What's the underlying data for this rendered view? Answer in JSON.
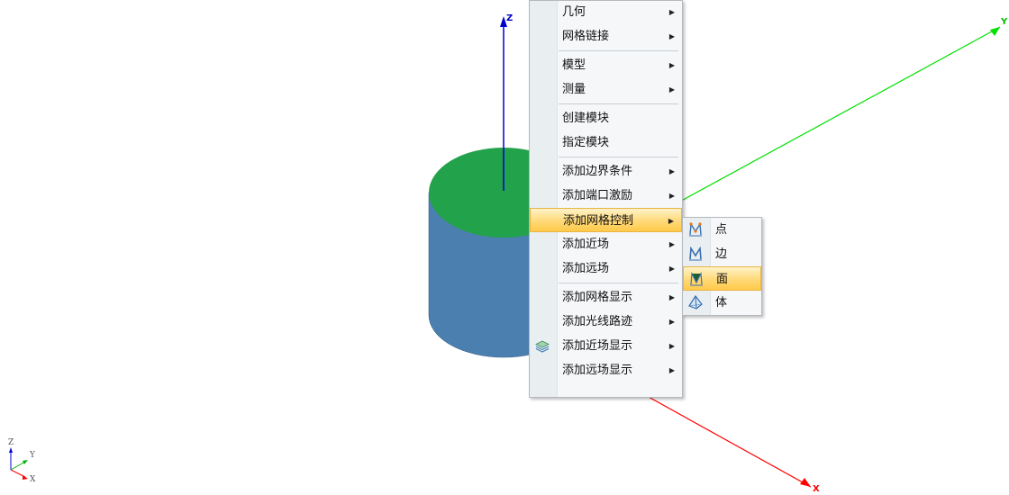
{
  "scene": {
    "axis_labels": {
      "z": "Z",
      "y": "Y",
      "x": "X"
    },
    "triad_labels": {
      "z": "Z",
      "y": "Y",
      "x": "X"
    },
    "colors": {
      "x_axis": "#ff0000",
      "y_axis": "#00e000",
      "z_axis": "#0000cc",
      "cylinder_top": "#22a24b",
      "cylinder_side": "#4a7fb0"
    }
  },
  "context_menu": {
    "items": [
      {
        "label": "几何",
        "submenu": true
      },
      {
        "label": "网格链接",
        "submenu": true
      },
      {
        "label": "模型",
        "submenu": true
      },
      {
        "label": "测量",
        "submenu": true
      },
      {
        "label": "创建模块",
        "submenu": false
      },
      {
        "label": "指定模块",
        "submenu": false
      },
      {
        "label": "添加边界条件",
        "submenu": true
      },
      {
        "label": "添加端口激励",
        "submenu": true
      },
      {
        "label": "添加网格控制",
        "submenu": true,
        "highlighted": true
      },
      {
        "label": "添加近场",
        "submenu": true
      },
      {
        "label": "添加远场",
        "submenu": true
      },
      {
        "label": "添加网格显示",
        "submenu": true
      },
      {
        "label": "添加光线路迹",
        "submenu": true
      },
      {
        "label": "添加近场显示",
        "submenu": true,
        "icon": "layers-icon"
      },
      {
        "label": "添加远场显示",
        "submenu": true
      }
    ],
    "arrow_glyph": "▶"
  },
  "submenu": {
    "items": [
      {
        "label": "点",
        "icon": "mesh-point-icon"
      },
      {
        "label": "边",
        "icon": "mesh-edge-icon"
      },
      {
        "label": "面",
        "icon": "mesh-face-icon",
        "highlighted": true
      },
      {
        "label": "体",
        "icon": "mesh-volume-icon"
      }
    ]
  }
}
